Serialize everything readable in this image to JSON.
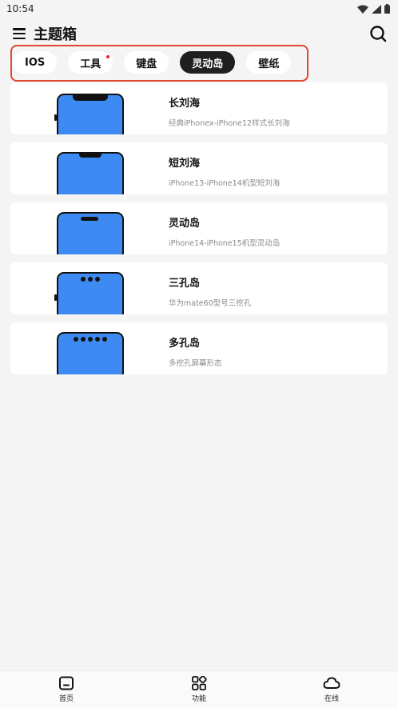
{
  "status_bar": {
    "time": "10:54"
  },
  "app_bar": {
    "title": "主题箱",
    "menu_icon": "menu-icon",
    "search_icon": "search-icon"
  },
  "tabs": [
    {
      "label": "IOS",
      "active": false,
      "dot": false
    },
    {
      "label": "工具",
      "active": false,
      "dot": true
    },
    {
      "label": "键盘",
      "active": false,
      "dot": false
    },
    {
      "label": "灵动岛",
      "active": true,
      "dot": false
    },
    {
      "label": "壁纸",
      "active": false,
      "dot": false
    }
  ],
  "items": [
    {
      "title": "长刘海",
      "subtitle": "经典iPhonex-iPhone12样式长刘海",
      "cutout": "long-notch"
    },
    {
      "title": "短刘海",
      "subtitle": "iPhone13-iPhone14机型短刘海",
      "cutout": "short-notch"
    },
    {
      "title": "灵动岛",
      "subtitle": "iPhone14-iPhone15机型灵动岛",
      "cutout": "island"
    },
    {
      "title": "三孔岛",
      "subtitle": "华为mate60型号三挖孔",
      "cutout": "three-holes"
    },
    {
      "title": "多孔岛",
      "subtitle": "多挖孔屏幕形态",
      "cutout": "five-holes"
    }
  ],
  "bottom_nav": [
    {
      "label": "首页",
      "icon": "home-icon"
    },
    {
      "label": "功能",
      "icon": "apps-icon"
    },
    {
      "label": "在线",
      "icon": "cloud-icon"
    }
  ],
  "colors": {
    "accent": "#1f1f1f",
    "phone_screen": "#3d8bf2",
    "highlight_frame": "#e04836",
    "tab_dot": "#e5202a"
  }
}
